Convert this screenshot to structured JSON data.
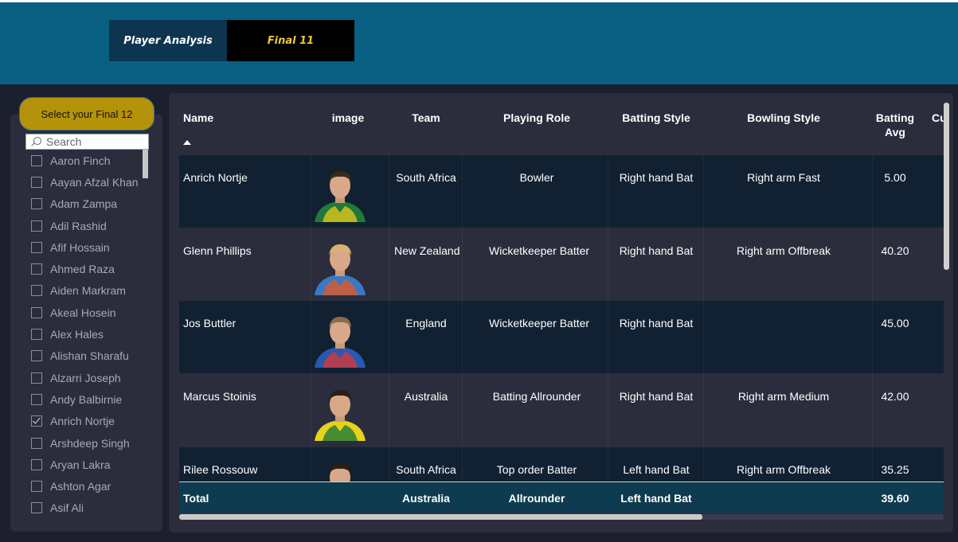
{
  "tabs": {
    "player_analysis": "Player Analysis",
    "final11": "Final 11"
  },
  "slicer": {
    "title": "Select your Final 12",
    "search_placeholder": "Search",
    "items": [
      {
        "label": "Aaron Finch",
        "checked": false
      },
      {
        "label": "Aayan Afzal Khan",
        "checked": false
      },
      {
        "label": "Adam Zampa",
        "checked": false
      },
      {
        "label": "Adil Rashid",
        "checked": false
      },
      {
        "label": "Afif Hossain",
        "checked": false
      },
      {
        "label": "Ahmed Raza",
        "checked": false
      },
      {
        "label": "Aiden Markram",
        "checked": false
      },
      {
        "label": "Akeal Hosein",
        "checked": false
      },
      {
        "label": "Alex Hales",
        "checked": false
      },
      {
        "label": "Alishan Sharafu",
        "checked": false
      },
      {
        "label": "Alzarri Joseph",
        "checked": false
      },
      {
        "label": "Andy Balbirnie",
        "checked": false
      },
      {
        "label": "Anrich Nortje",
        "checked": true
      },
      {
        "label": "Arshdeep Singh",
        "checked": false
      },
      {
        "label": "Aryan Lakra",
        "checked": false
      },
      {
        "label": "Ashton Agar",
        "checked": false
      },
      {
        "label": "Asif Ali",
        "checked": false
      }
    ]
  },
  "table": {
    "headers": {
      "name": "Name",
      "image": "image",
      "team": "Team",
      "role": "Playing Role",
      "batting_style": "Batting Style",
      "bowling_style": "Bowling Style",
      "batting_avg_1": "Batting",
      "batting_avg_2": "Avg",
      "next": "Cu"
    },
    "rows": [
      {
        "name": "Anrich Nortje",
        "team": "South Africa",
        "role": "Bowler",
        "batting_style": "Right hand Bat",
        "bowling_style": "Right arm Fast",
        "batting_avg": "5.00",
        "jersey": "#1f7a3a",
        "jersey2": "#e0c51a",
        "hair": "#3d2a1a"
      },
      {
        "name": "Glenn Phillips",
        "team": "New Zealand",
        "role": "Wicketkeeper Batter",
        "batting_style": "Right hand Bat",
        "bowling_style": "Right arm Offbreak",
        "batting_avg": "40.20",
        "jersey": "#3a78c4",
        "jersey2": "#e05a2a",
        "hair": "#d8b46a"
      },
      {
        "name": "Jos Buttler",
        "team": "England",
        "role": "Wicketkeeper Batter",
        "batting_style": "Right hand Bat",
        "bowling_style": "",
        "batting_avg": "45.00",
        "jersey": "#2a58b0",
        "jersey2": "#d23a3a",
        "hair": "#8a6a4a"
      },
      {
        "name": "Marcus Stoinis",
        "team": "Australia",
        "role": "Batting Allrounder",
        "batting_style": "Right hand Bat",
        "bowling_style": "Right arm Medium",
        "batting_avg": "42.00",
        "jersey": "#e8d21c",
        "jersey2": "#1f7a3a",
        "hair": "#2a1e14"
      },
      {
        "name": "Rilee Rossouw",
        "team": "South Africa",
        "role": "Top order Batter",
        "batting_style": "Left hand Bat",
        "bowling_style": "Right arm Offbreak",
        "batting_avg": "35.25",
        "jersey": "#1f7a3a",
        "jersey2": "#e0c51a",
        "hair": "#2a1e14"
      }
    ],
    "total": {
      "label": "Total",
      "team": "Australia",
      "role": "Allrounder",
      "batting_style": "Left hand Bat",
      "bowling_style": "",
      "batting_avg": "39.60"
    }
  }
}
